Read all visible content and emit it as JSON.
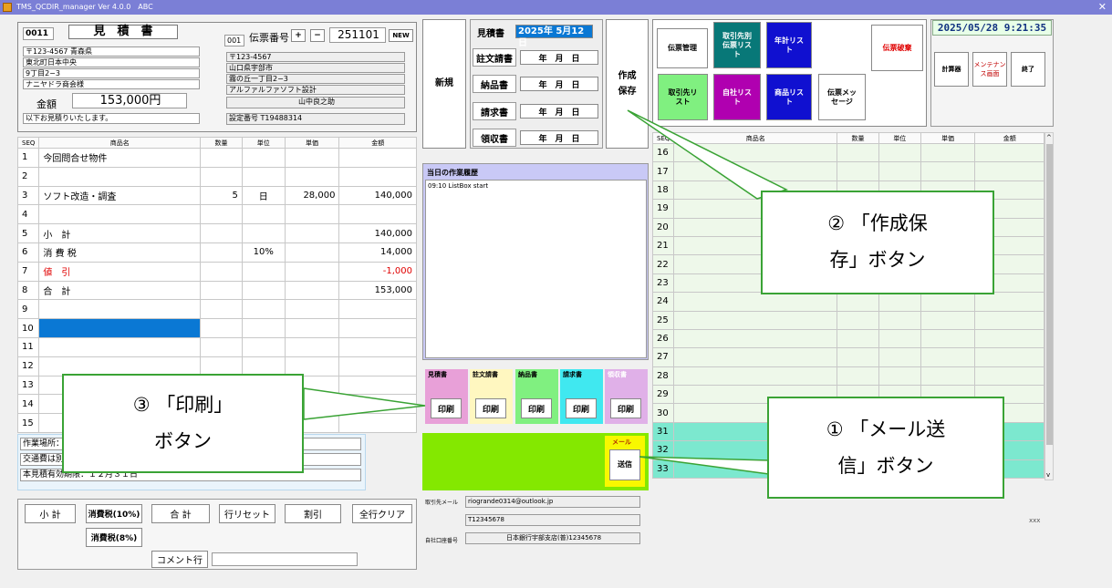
{
  "window": {
    "title": "TMS_QCDIR_manager Ver 4.0.0　ABC",
    "close": "✕"
  },
  "estimate": {
    "code": "0011",
    "title": "見　積　書",
    "address": [
      "〒123-4567 青森県",
      "東北町日本中央",
      "9丁目2−3",
      "ナニヤドラ商会様"
    ],
    "amount_label": "金額",
    "amount": "153,000円",
    "note": "以下お見積りいたします。"
  },
  "slip": {
    "code": "001",
    "label": "伝票番号",
    "plus": "+",
    "minus": "−",
    "number": "251101",
    "new_label": "NEW",
    "sender": [
      "〒123-4567",
      "山口県宇部市",
      "霧の丘一丁目2−3",
      "アルファルファソフト設計"
    ],
    "person": "山中良之助",
    "reg_no": "設定番号 T19488314"
  },
  "grid_left": {
    "headers": [
      "SEQ",
      "商品名",
      "数量",
      "単位",
      "単価",
      "金額"
    ],
    "rows": [
      [
        "1",
        "今回問合せ物件",
        "",
        "",
        "",
        ""
      ],
      [
        "2",
        "",
        "",
        "",
        "",
        ""
      ],
      [
        "3",
        "ソフト改造・調査",
        "5",
        "日",
        "28,000",
        "140,000"
      ],
      [
        "4",
        "",
        "",
        "",
        "",
        ""
      ],
      [
        "5",
        "小　計",
        "",
        "",
        "",
        "140,000"
      ],
      [
        "6",
        "消 費 税",
        "",
        "10%",
        "",
        "14,000"
      ],
      [
        "7",
        "値　引",
        "",
        "",
        "",
        "-1,000"
      ],
      [
        "8",
        "合　計",
        "",
        "",
        "",
        "153,000"
      ],
      [
        "9",
        "",
        "",
        "",
        "",
        ""
      ],
      [
        "10",
        "",
        "",
        "",
        "",
        ""
      ],
      [
        "11",
        "",
        "",
        "",
        "",
        ""
      ],
      [
        "12",
        "",
        "",
        "",
        "",
        ""
      ],
      [
        "13",
        "",
        "",
        "",
        "",
        ""
      ],
      [
        "14",
        "",
        "",
        "",
        "",
        ""
      ],
      [
        "15",
        "",
        "",
        "",
        "",
        ""
      ]
    ]
  },
  "notes": {
    "work_place": "作業場所：",
    "transport": "交通費は別",
    "validity": "本見積有効期限：１２月３１日"
  },
  "bottom_buttons": {
    "subtotal": "小 計",
    "tax10": "消費税(10%)",
    "total": "合 計",
    "row_reset": "行リセット",
    "discount": "割引",
    "clear_all": "全行クリア",
    "tax8": "消費税(8%)",
    "comment": "コメント行"
  },
  "docs": {
    "new": "新規",
    "estimate_label": "見積書",
    "estimate_date": "2025年 5月12日",
    "order_label": "註文請書",
    "delivery_label": "納品書",
    "invoice_label": "請求書",
    "receipt_label": "領収書",
    "blank_date": "年　月　日",
    "save": "作成\n保存"
  },
  "history": {
    "title": "当日の作業履歴",
    "entry": "09:10  ListBox start"
  },
  "print": {
    "estimate": "見積書",
    "order": "註文請書",
    "delivery": "納品書",
    "invoice": "請求書",
    "receipt": "領収書",
    "button": "印刷"
  },
  "mail": {
    "label": "メール",
    "send": "送信"
  },
  "contact": {
    "email_label": "取引先メール",
    "email": "riogrande0314@outlook.jp",
    "tno": "T12345678",
    "bank_label": "自社口座番号",
    "bank": "日本銀行宇部支店(普)12345678"
  },
  "menu": {
    "slip_mgmt": "伝票管理",
    "customer_slip_list": "取引先別\n伝票リス\nト",
    "annual_list": "年計リス\nト",
    "destroy": "伝票破棄",
    "customer_list": "取引先リ\nスト",
    "company_list": "自社リス\nト",
    "product_list": "商品リス\nト",
    "slip_message": "伝票メッ\nセージ",
    "calculator": "計算器",
    "maintenance": "メンテナン\nス画面",
    "exit": "終了"
  },
  "clock": "2025/05/28  9:21:35",
  "grid_right": {
    "headers": [
      "SEQ",
      "商品名",
      "数量",
      "単位",
      "単価",
      "金額"
    ],
    "rows": [
      "16",
      "17",
      "18",
      "19",
      "20",
      "21",
      "22",
      "23",
      "24",
      "25",
      "26",
      "27",
      "28",
      "29",
      "30",
      "31",
      "32",
      "33"
    ]
  },
  "footer_text": "xxx",
  "callouts": {
    "save": "② 「作成保\n存」ボタン",
    "print": "③ 「印刷」\nボタン",
    "mail": "① 「メール送\n信」ボタン"
  },
  "colors": {
    "titlebar": "#7b7fd6",
    "teal": "#087878",
    "magenta": "#b000b0",
    "blue": "#1010d0",
    "green": "#80f080",
    "callout_border": "#3aa335",
    "selected": "#0a78d4"
  }
}
